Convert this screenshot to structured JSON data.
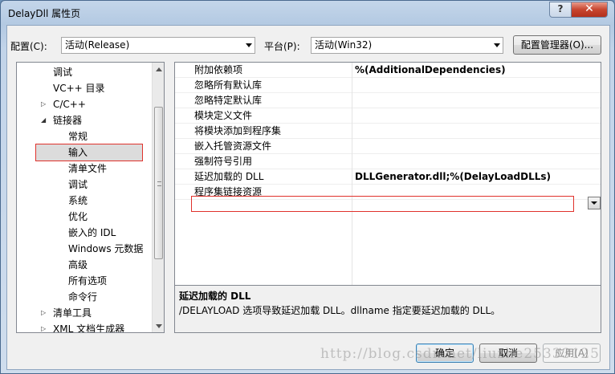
{
  "window": {
    "title": "DelayDll 属性页",
    "help_glyph": "?",
    "close_glyph": "✕"
  },
  "config": {
    "config_label": "配置(C):",
    "config_value": "活动(Release)",
    "platform_label": "平台(P):",
    "platform_value": "活动(Win32)",
    "manager_button": "配置管理器(O)..."
  },
  "tree": {
    "items": [
      {
        "label": "调试",
        "indent": 0,
        "expander": ""
      },
      {
        "label": "VC++ 目录",
        "indent": 0,
        "expander": ""
      },
      {
        "label": "C/C++",
        "indent": 0,
        "expander": "▷"
      },
      {
        "label": "链接器",
        "indent": 0,
        "expander": "◢"
      },
      {
        "label": "常规",
        "indent": 1,
        "expander": ""
      },
      {
        "label": "输入",
        "indent": 1,
        "expander": ""
      },
      {
        "label": "清单文件",
        "indent": 1,
        "expander": ""
      },
      {
        "label": "调试",
        "indent": 1,
        "expander": ""
      },
      {
        "label": "系统",
        "indent": 1,
        "expander": ""
      },
      {
        "label": "优化",
        "indent": 1,
        "expander": ""
      },
      {
        "label": "嵌入的 IDL",
        "indent": 1,
        "expander": ""
      },
      {
        "label": "Windows 元数据",
        "indent": 1,
        "expander": ""
      },
      {
        "label": "高级",
        "indent": 1,
        "expander": ""
      },
      {
        "label": "所有选项",
        "indent": 1,
        "expander": ""
      },
      {
        "label": "命令行",
        "indent": 1,
        "expander": ""
      },
      {
        "label": "清单工具",
        "indent": 0,
        "expander": "▷"
      },
      {
        "label": "XML 文档生成器",
        "indent": 0,
        "expander": "▷"
      }
    ],
    "selected": "输入"
  },
  "properties": [
    {
      "name": "附加依赖项",
      "value": "%(AdditionalDependencies)"
    },
    {
      "name": "忽略所有默认库",
      "value": ""
    },
    {
      "name": "忽略特定默认库",
      "value": ""
    },
    {
      "name": "模块定义文件",
      "value": ""
    },
    {
      "name": "将模块添加到程序集",
      "value": ""
    },
    {
      "name": "嵌入托管资源文件",
      "value": ""
    },
    {
      "name": "强制符号引用",
      "value": ""
    },
    {
      "name": "延迟加载的 DLL",
      "value": "DLLGenerator.dll;%(DelayLoadDLLs)"
    },
    {
      "name": "程序集链接资源",
      "value": ""
    }
  ],
  "description": {
    "title": "延迟加载的 DLL",
    "text": "/DELAYLOAD 选项导致延迟加载 DLL。dllname 指定要延迟加载的 DLL。"
  },
  "buttons": {
    "ok": "确定",
    "cancel": "取消",
    "apply": "应用(A)"
  },
  "watermark": "http://blog.csdn.net/liuzhe25333125"
}
